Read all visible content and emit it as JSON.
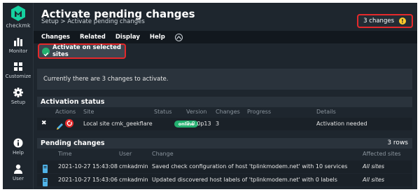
{
  "app": {
    "logo_text": "checkmk"
  },
  "sidebar": {
    "items": [
      {
        "label": "Monitor",
        "icon": "monitor-icon"
      },
      {
        "label": "Customize",
        "icon": "customize-icon"
      },
      {
        "label": "Setup",
        "icon": "gear-icon"
      },
      {
        "label": "Help",
        "icon": "info-icon"
      },
      {
        "label": "User",
        "icon": "user-icon"
      }
    ]
  },
  "header": {
    "title": "Activate pending changes",
    "breadcrumb": "Setup > Activate pending changes",
    "changes_label": "3 changes",
    "warn_glyph": "!"
  },
  "menu": {
    "items": [
      "Changes",
      "Related",
      "Display",
      "Help"
    ]
  },
  "action": {
    "button_label": "Activate on selected sites"
  },
  "info": {
    "text": "Currently there are 3 changes to activate."
  },
  "activation_status": {
    "title": "Activation status",
    "headers": [
      "Actions",
      "Site",
      "Status",
      "Version",
      "Changes",
      "Progress",
      "Details"
    ],
    "rows": [
      {
        "site": "Local site cmk_geekflare",
        "status": "online",
        "version": "2.0.0p13",
        "changes": "3",
        "progress": "",
        "details": "Activation needed"
      }
    ]
  },
  "pending_changes": {
    "title": "Pending changes",
    "count": "3 rows",
    "headers": [
      "Time",
      "User",
      "Change",
      "Affected sites"
    ],
    "rows": [
      {
        "time": "2021-10-27 15:43:08",
        "user": "cmkadmin",
        "change": "Saved check configuration of host 'tplinkmodem.net' with 10 services",
        "sites": "All sites"
      },
      {
        "time": "2021-10-27 15:43:06",
        "user": "cmkadmin",
        "change": "Updated discovered host labels of 'tplinkmodem.net' with 0 labels",
        "sites": "All sites"
      }
    ]
  },
  "colors": {
    "background": "#1e262e",
    "accent_green": "#23b06f",
    "highlight_red": "#e5292b",
    "warning_yellow": "#ffcb2b"
  }
}
